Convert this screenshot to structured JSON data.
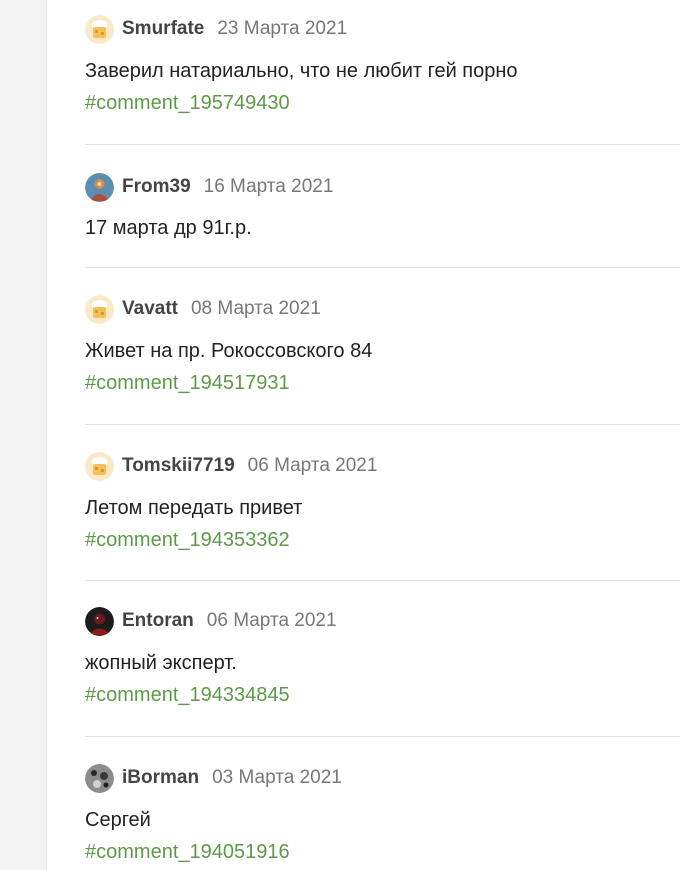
{
  "colors": {
    "author": "#444444",
    "date": "#777777",
    "text": "#222222",
    "link": "#5d9a48",
    "divider": "#e2e2e2"
  },
  "comments": [
    {
      "author": "Smurfate",
      "date": "23 Марта 2021",
      "text": "Заверил натариально, что не любит гей порно",
      "link": "#comment_195749430",
      "avatar": "chef-avatar-icon"
    },
    {
      "author": "From39",
      "date": "16 Марта 2021",
      "text": "17 марта др 91г.р.",
      "link": "",
      "avatar": "user-photo-avatar"
    },
    {
      "author": "Vavatt",
      "date": "08 Марта 2021",
      "text": "Живет на пр. Рокоссовского 84",
      "link": "#comment_194517931",
      "avatar": "chef-avatar-icon"
    },
    {
      "author": "Tomskii7719",
      "date": "06 Марта 2021",
      "text": "Летом передать привет",
      "link": "#comment_194353362",
      "avatar": "chef-avatar-icon"
    },
    {
      "author": "Entoran",
      "date": "06 Марта 2021",
      "text": "жопный эксперт.",
      "link": "#comment_194334845",
      "avatar": "user-photo-avatar"
    },
    {
      "author": "iBorman",
      "date": "03 Марта 2021",
      "text": "Сергей",
      "link": "#comment_194051916",
      "avatar": "user-photo-avatar"
    }
  ]
}
